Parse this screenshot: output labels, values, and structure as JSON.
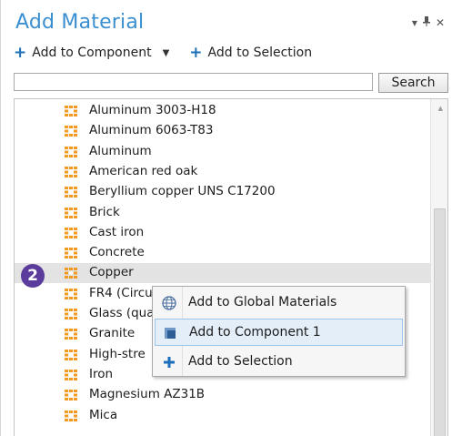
{
  "panel": {
    "title": "Add Material",
    "controls": {
      "dropdown_icon": "▾",
      "pin_icon": "⊥",
      "close_icon": "✕"
    }
  },
  "toolbar": {
    "add_component_label": "Add to Component",
    "add_selection_label": "Add to Selection"
  },
  "search": {
    "value": "",
    "placeholder": "",
    "button_label": "Search"
  },
  "materials": [
    "Aluminum 3003-H18",
    "Aluminum 6063-T83",
    "Aluminum",
    "American red oak",
    "Beryllium copper UNS C17200",
    "Brick",
    "Cast iron",
    "Concrete",
    "Copper",
    "FR4 (Circu",
    "Glass (qua",
    "Granite",
    "High-stre",
    "Iron",
    "Magnesium AZ31B",
    "Mica"
  ],
  "selected_material": "Copper",
  "step_badge": "2",
  "context_menu": {
    "items": [
      {
        "label": "Add to Global Materials",
        "icon": "globe-icon"
      },
      {
        "label": "Add to Component 1",
        "icon": "component-icon"
      },
      {
        "label": "Add to Selection",
        "icon": "plus-icon"
      }
    ]
  },
  "colors": {
    "title": "#3a8fd0",
    "plus": "#1a6fb8",
    "badge": "#5b3b9b",
    "material_icon": "#f29a1f",
    "highlight": "#e4eef9"
  }
}
